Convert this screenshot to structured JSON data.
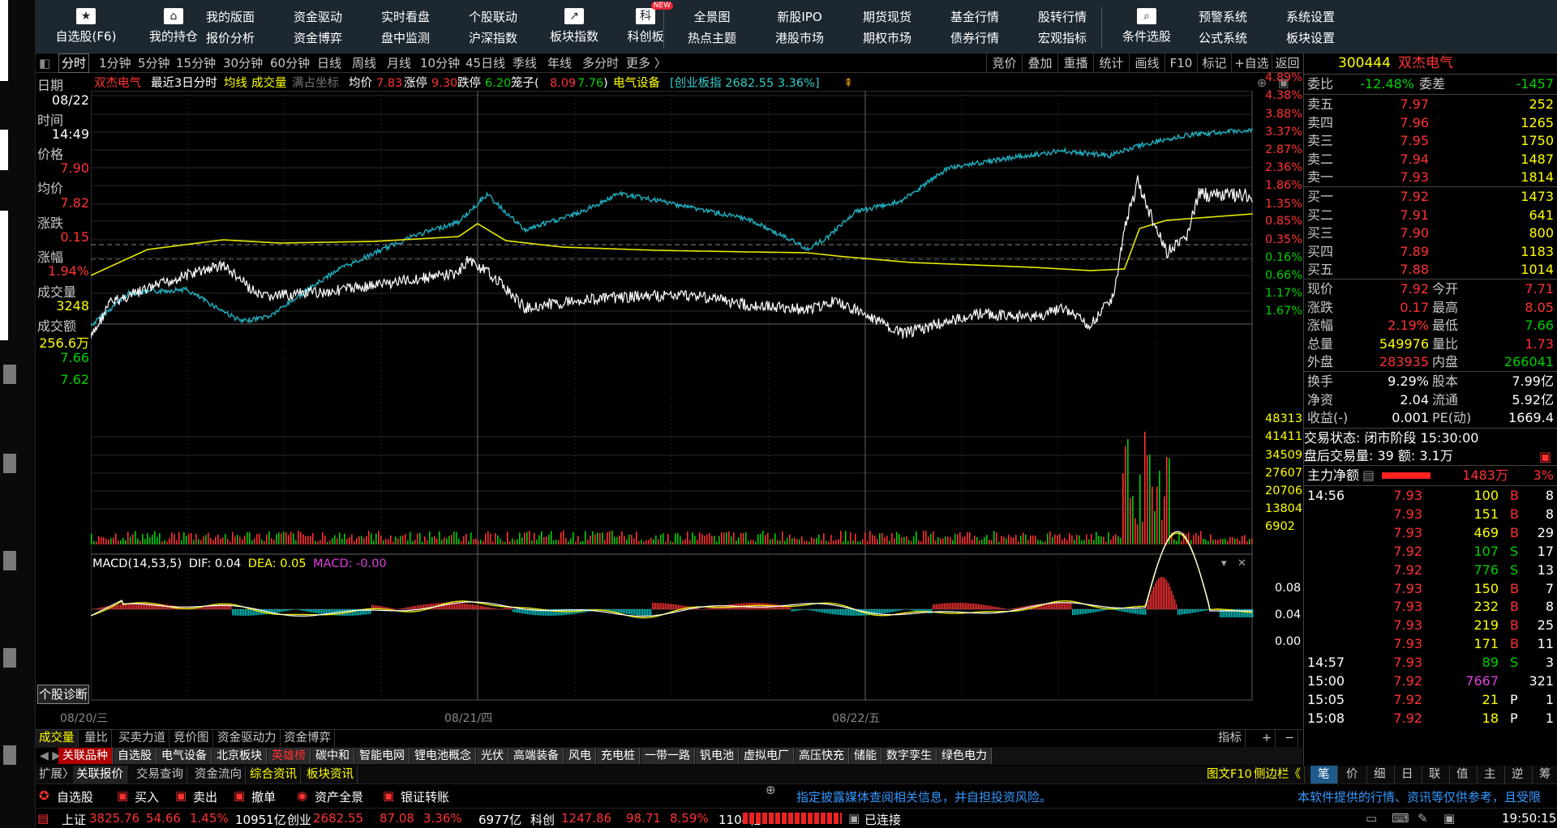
{
  "toolbar": {
    "buttons": [
      {
        "label": "自选股(F6)",
        "icon": "star-icon"
      },
      {
        "label": "我的持仓",
        "icon": "home-icon"
      }
    ],
    "grid_left": [
      [
        "我的版面",
        "报价分析"
      ],
      [
        "资金驱动",
        "资金博弈"
      ],
      [
        "实时看盘",
        "盘中监测"
      ],
      [
        "个股联动",
        "沪深指数"
      ]
    ],
    "buttons2": [
      {
        "label": "板块指数",
        "icon": "chart-icon"
      },
      {
        "label": "科创板",
        "icon": "kechuang-icon",
        "badge": "NEW"
      }
    ],
    "grid_mid": [
      [
        "全景图",
        "热点主题"
      ],
      [
        "新股IPO",
        "港股市场"
      ],
      [
        "期货现货",
        "期权市场"
      ],
      [
        "基金行情",
        "债券行情"
      ],
      [
        "股转行情",
        "宏观指标"
      ]
    ],
    "button3": {
      "label": "条件选股",
      "icon": "search-chart-icon"
    },
    "grid_right": [
      [
        "预警系统",
        "公式系统"
      ],
      [
        "系统设置",
        "板块设置"
      ]
    ]
  },
  "periods": [
    "分时",
    "1分钟",
    "5分钟",
    "15分钟",
    "30分钟",
    "60分钟",
    "日线",
    "周线",
    "月线",
    "10分钟",
    "45日线",
    "季线",
    "年线",
    "多分时",
    "更多 〉"
  ],
  "right_tools": [
    "竞价",
    "叠加",
    "重播",
    "统计",
    "画线",
    "F10",
    "标记",
    "+自选",
    "返回"
  ],
  "info": {
    "name": "双杰电气",
    "range": "最近3日分时",
    "avg_line": "均线",
    "volume": "成交量",
    "full_coord": "满占坐标",
    "avg_label": "均价",
    "avg_value": "7.83",
    "limit_up_label": "涨停",
    "limit_up": "9.30",
    "limit_down_label": "跌停",
    "limit_down": "6.20",
    "cage_label": "笼子(",
    "cage_hi": "8.09",
    "cage_lo": "7.76",
    "cage_close": ")",
    "sector": "电气设备",
    "index": "[创业板指 2682.55 3.36%]"
  },
  "side": {
    "date_label": "日期",
    "date": "08/22",
    "time_label": "时间",
    "time": "14:49",
    "price_label": "价格",
    "price": "7.90",
    "avg_label": "均价",
    "avg": "7.82",
    "chg_label": "涨跌",
    "chg": "0.15",
    "pct_label": "涨幅",
    "pct": "1.94%",
    "vol_label": "成交量",
    "vol": "3248",
    "amt_label": "成交额",
    "amt": "256.6万",
    "p1": "7.66",
    "p2": "7.62",
    "diag": "个股诊断"
  },
  "pct_axis": [
    "4.89%",
    "4.38%",
    "3.88%",
    "3.37%",
    "2.87%",
    "2.36%",
    "1.86%",
    "1.35%",
    "0.85%",
    "0.35%",
    "0.16%",
    "0.66%",
    "1.17%",
    "1.67%"
  ],
  "vol_axis": [
    "48313",
    "41411",
    "34509",
    "27607",
    "20706",
    "13804",
    "6902"
  ],
  "macd": {
    "label": "MACD(14,53,5)",
    "dif": "DIF: 0.04",
    "dea": "DEA: 0.05",
    "macd": "MACD: -0.00",
    "axis": [
      "0.08",
      "0.04",
      "0.00"
    ]
  },
  "dates": [
    "08/20/三",
    "08/21/四",
    "08/22/五"
  ],
  "tabs1": [
    "成交量",
    "量比",
    "买卖力道",
    "竞价图",
    "资金驱动力",
    "资金博弈"
  ],
  "tabs1_right": [
    "指标",
    "+",
    "−"
  ],
  "sectors": [
    "关联品种",
    "自选股",
    "电气设备",
    "北京板块",
    "英雄榜",
    "碳中和",
    "智能电网",
    "锂电池概念",
    "光伏",
    "高端装备",
    "风电",
    "充电桩",
    "一带一路",
    "钒电池",
    "虚拟电厂",
    "高压快充",
    "储能",
    "数字孪生",
    "绿色电力"
  ],
  "row3": [
    "扩展〉",
    "关联报价",
    "交易查询",
    "资金流向",
    "综合资讯",
    "板块资讯"
  ],
  "row3_right": [
    "图文F10",
    "侧边栏《",
    "笔",
    "价",
    "细",
    "日",
    "联",
    "值",
    "主",
    "逆",
    "筹"
  ],
  "trade_buttons": [
    "自选股",
    "买入",
    "卖出",
    "撤单",
    "资产全景",
    "银证转账"
  ],
  "ticker_msg": "指定披露媒体查阅相关信息，并自担投资风险。",
  "ticker_msg2": "本软件提供的行情、资讯等仅供参考，且受限",
  "status": {
    "sh_label": "上证",
    "sh": "3825.76",
    "sh_chg": "54.66",
    "sh_pct": "1.45%",
    "sh_amt": "10951亿",
    "cy_label": "创业",
    "cy": "2682.55",
    "cy_chg": "87.08",
    "cy_pct": "3.36%",
    "cy_amt": "6977亿",
    "kc_label": "科创",
    "kc": "1247.86",
    "kc_chg": "98.71",
    "kc_pct": "8.59%",
    "kc_amt": "1104亿",
    "conn": "已连接",
    "clock": "19:50:15"
  },
  "quote": {
    "code": "300444",
    "name": "双杰电气",
    "wb_label": "委比",
    "wb": "-12.48%",
    "wc_label": "委差",
    "wc": "-1457",
    "asks": [
      [
        "卖五",
        "7.97",
        "252"
      ],
      [
        "卖四",
        "7.96",
        "1265"
      ],
      [
        "卖三",
        "7.95",
        "1750"
      ],
      [
        "卖二",
        "7.94",
        "1487"
      ],
      [
        "卖一",
        "7.93",
        "1814"
      ]
    ],
    "bids": [
      [
        "买一",
        "7.92",
        "1473"
      ],
      [
        "买二",
        "7.91",
        "641"
      ],
      [
        "买三",
        "7.90",
        "800"
      ],
      [
        "买四",
        "7.89",
        "1183"
      ],
      [
        "买五",
        "7.88",
        "1014"
      ]
    ],
    "stats": [
      [
        "现价",
        "7.92",
        "今开",
        "7.71"
      ],
      [
        "涨跌",
        "0.17",
        "最高",
        "8.05"
      ],
      [
        "涨幅",
        "2.19%",
        "最低",
        "7.66"
      ],
      [
        "总量",
        "549976",
        "量比",
        "1.73"
      ],
      [
        "外盘",
        "283935",
        "内盘",
        "266041"
      ]
    ],
    "stats2": [
      [
        "换手",
        "9.29%",
        "股本",
        "7.99亿"
      ],
      [
        "净资",
        "2.04",
        "流通",
        "5.92亿"
      ],
      [
        "收益(-)",
        "0.001",
        "PE(动)",
        "1669.4"
      ]
    ],
    "trade_status": "交易状态: 闭市阶段 15:30:00",
    "after_hours": "盘后交易量: 39  额: 3.1万",
    "main_flow_label": "主力净额",
    "main_flow": "1483万",
    "main_flow_pct": "3%",
    "ticks": [
      [
        "14:56",
        "7.93",
        "100",
        "B",
        "8"
      ],
      [
        "",
        "7.93",
        "151",
        "B",
        "8"
      ],
      [
        "",
        "7.93",
        "469",
        "B",
        "29"
      ],
      [
        "",
        "7.92",
        "107",
        "S",
        "17"
      ],
      [
        "",
        "7.92",
        "776",
        "S",
        "13"
      ],
      [
        "",
        "7.93",
        "150",
        "B",
        "7"
      ],
      [
        "",
        "7.93",
        "232",
        "B",
        "8"
      ],
      [
        "",
        "7.93",
        "219",
        "B",
        "25"
      ],
      [
        "",
        "7.93",
        "171",
        "B",
        "11"
      ],
      [
        "14:57",
        "7.93",
        "89",
        "S",
        "3"
      ],
      [
        "15:00",
        "7.92",
        "7667",
        "",
        "321"
      ],
      [
        "15:05",
        "7.92",
        "21",
        "P",
        "1"
      ],
      [
        "15:08",
        "7.92",
        "18",
        "P",
        "1"
      ]
    ]
  },
  "colors": {
    "up": "#ff3232",
    "down": "#00d000",
    "yellow": "#ffff00",
    "cyan": "#3cc",
    "price": "#ffffff",
    "avg": "#e8e800",
    "bench": "#20b0c0"
  }
}
